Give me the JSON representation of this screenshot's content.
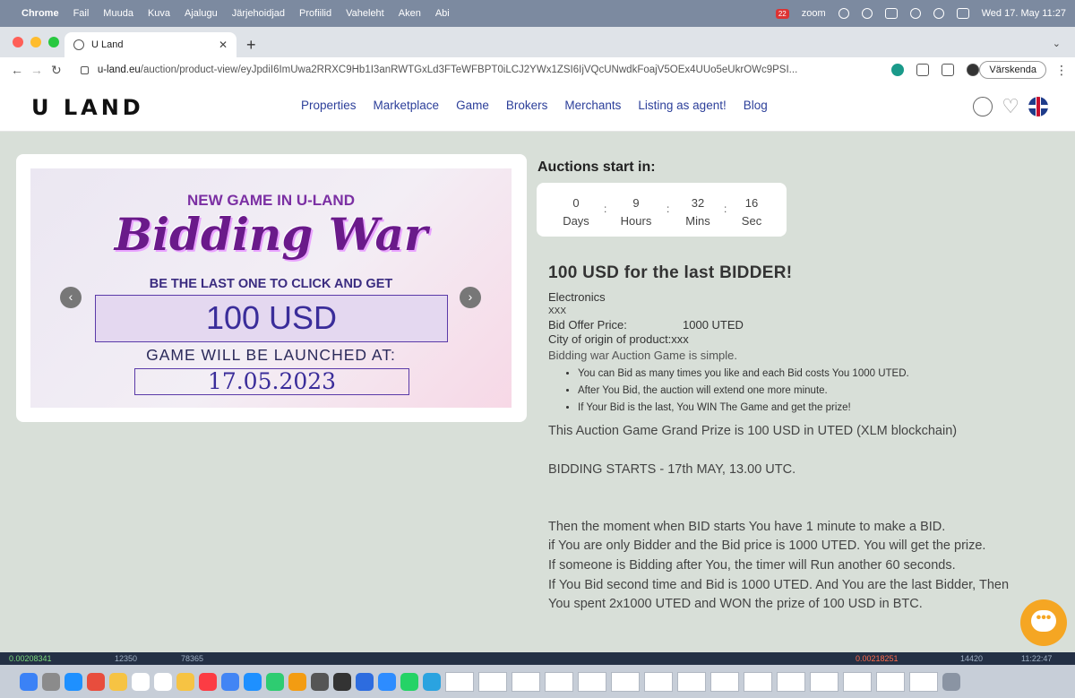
{
  "menubar": {
    "app": "Chrome",
    "items": [
      "Fail",
      "Muuda",
      "Kuva",
      "Ajalugu",
      "Järjehoidjad",
      "Profiilid",
      "Vaheleht",
      "Aken",
      "Abi"
    ],
    "badge": "22",
    "zoom": "zoom",
    "clock": "Wed 17. May  11:27"
  },
  "tab": {
    "title": "U Land"
  },
  "address": {
    "host": "u-land.eu",
    "path": "/auction/product-view/eyJpdiI6ImUwa2RRXC9Hb1I3anRWTGxLd3FTeWFBPT0iLCJ2YWx1ZSI6IjVQcUNwdkFoajV5OEx4UUo5eUkrOWc9PSI...",
    "reload_label": "Värskenda"
  },
  "site": {
    "logo": "U LAND",
    "nav": [
      "Properties",
      "Marketplace",
      "Game",
      "Brokers",
      "Merchants",
      "Listing as agent!",
      "Blog"
    ]
  },
  "banner": {
    "top": "NEW GAME IN U-LAND",
    "title": "Bidding War",
    "sub": "BE THE LAST ONE TO CLICK AND GET",
    "prize": "100 USD",
    "launch": "GAME WILL BE LAUNCHED AT:",
    "date": "17.05.2023"
  },
  "countdown": {
    "title": "Auctions start in:",
    "units": [
      {
        "value": "0",
        "label": "Days"
      },
      {
        "value": "9",
        "label": "Hours"
      },
      {
        "value": "32",
        "label": "Mins"
      },
      {
        "value": "16",
        "label": "Sec"
      }
    ]
  },
  "product": {
    "title": "100 USD for the last BIDDER!",
    "category": "Electronics",
    "code": "XXX",
    "price_label": "Bid Offer Price:",
    "price_value": "1000 UTED",
    "origin": "City of origin of product:xxx",
    "intro": "Bidding war Auction Game is simple.",
    "bullets": [
      "You can Bid as many times you like and each Bid costs You 1000 UTED.",
      "After You Bid, the auction will extend one more minute.",
      "If Your Bid is the last, You WIN The Game and get the prize!"
    ],
    "grand_prize": "This Auction Game Grand Prize is 100 USD in UTED (XLM blockchain)",
    "bidding_starts": "BIDDING STARTS - 17th MAY, 13.00 UTC.",
    "rules": [
      "Then the moment when BID starts You have 1 minute to make a BID.",
      "if You are only Bidder and the Bid price is 1000 UTED. You will get the prize.",
      "If someone is Bidding after You, the timer will Run another 60 seconds.",
      "If You Bid second time and Bid is 1000 UTED. And You are the last Bidder, Then",
      "You spent 2x1000 UTED and WON the prize of 100 USD in BTC."
    ]
  },
  "ticker": {
    "a": "0.00208341",
    "b": "12350",
    "c": "78365",
    "d": "0.00218251",
    "e": "14420",
    "f": "11:22:47"
  },
  "colors": {
    "nav_link": "#2c3f9a",
    "chat_button": "#f5a623",
    "page_bg": "#d8dfd8"
  }
}
